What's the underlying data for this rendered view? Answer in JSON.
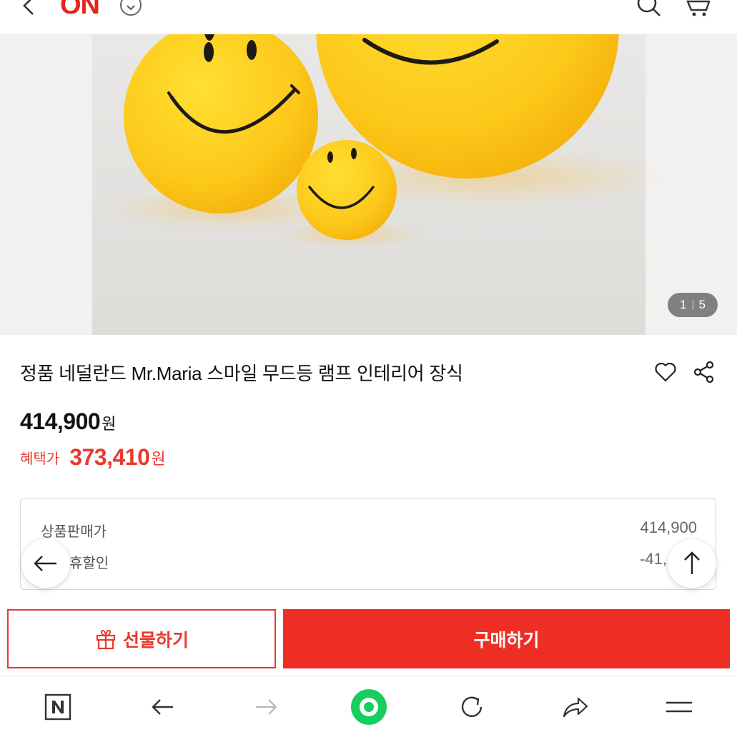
{
  "header": {
    "brand": "ON"
  },
  "gallery": {
    "current": "1",
    "total": "5"
  },
  "product": {
    "title": "정품 네덜란드 Mr.Maria 스마일 무드등 램프 인테리어 장식",
    "original_price": "414,900",
    "currency": "원",
    "benefit_label": "혜택가",
    "benefit_price": "373,410"
  },
  "price_breakdown": {
    "rows": [
      {
        "label": "상품판매가",
        "value": "414,900"
      },
      {
        "label": "휴할인",
        "value": "-41,"
      }
    ]
  },
  "actions": {
    "gift_label": "선물하기",
    "buy_label": "구매하기"
  },
  "icons": {
    "header": [
      "back-icon",
      "chevron-down-icon",
      "search-icon",
      "cart-icon"
    ],
    "product": [
      "heart-icon",
      "share-icon",
      "gift-icon"
    ],
    "floating": [
      "arrow-left-icon",
      "arrow-up-icon"
    ],
    "browser": [
      "naver-n-icon",
      "browser-back-icon",
      "browser-forward-icon",
      "home-dot-icon",
      "reload-icon",
      "share-arrow-icon",
      "menu-icon"
    ]
  },
  "colors": {
    "accent": "#ee2e24",
    "accent_text": "#e8392f",
    "green": "#19ce60"
  }
}
